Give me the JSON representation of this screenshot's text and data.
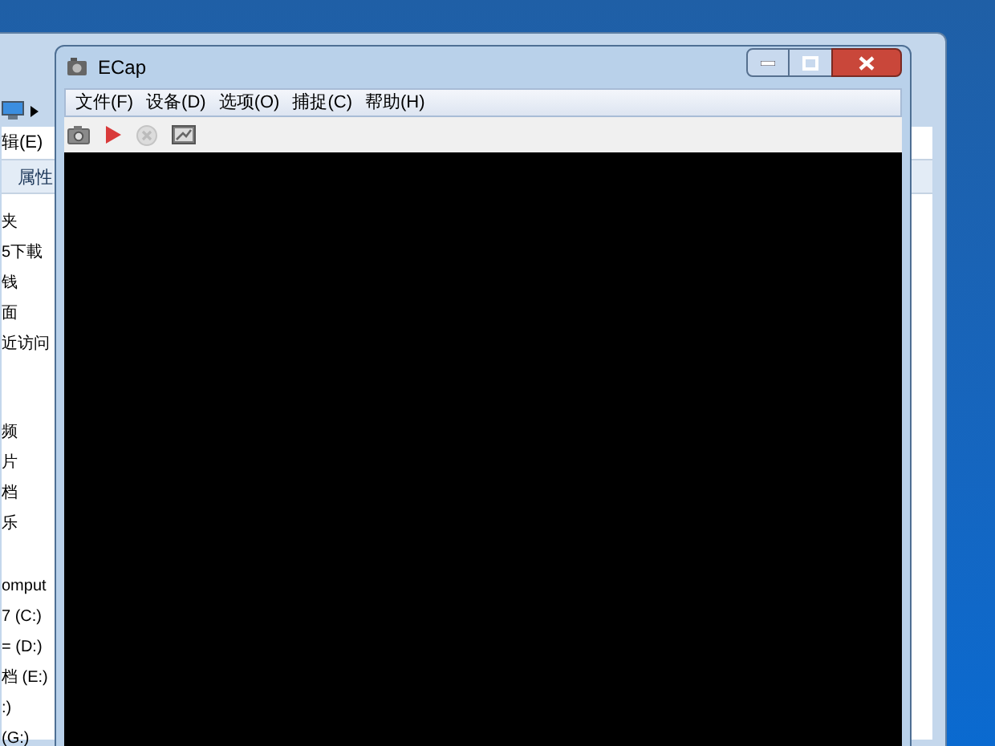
{
  "background_window": {
    "menu_fragment": "辑(E)",
    "toolbar_fragment": "属性",
    "nav_items": [
      "夹",
      "5下載",
      "钱",
      "面",
      "近访问",
      "频",
      "片",
      "档",
      "乐",
      "omput",
      "7 (C:)",
      "= (D:)",
      "档 (E:)",
      ":)",
      "(G:)"
    ]
  },
  "window": {
    "title": "ECap"
  },
  "menu": [
    "文件(F)",
    "设备(D)",
    "选项(O)",
    "捕捉(C)",
    "帮助(H)"
  ],
  "toolbar": [
    {
      "kind": "camera",
      "disabled": false
    },
    {
      "kind": "play",
      "disabled": false
    },
    {
      "kind": "stop",
      "disabled": true
    },
    {
      "kind": "picture",
      "disabled": false
    }
  ]
}
